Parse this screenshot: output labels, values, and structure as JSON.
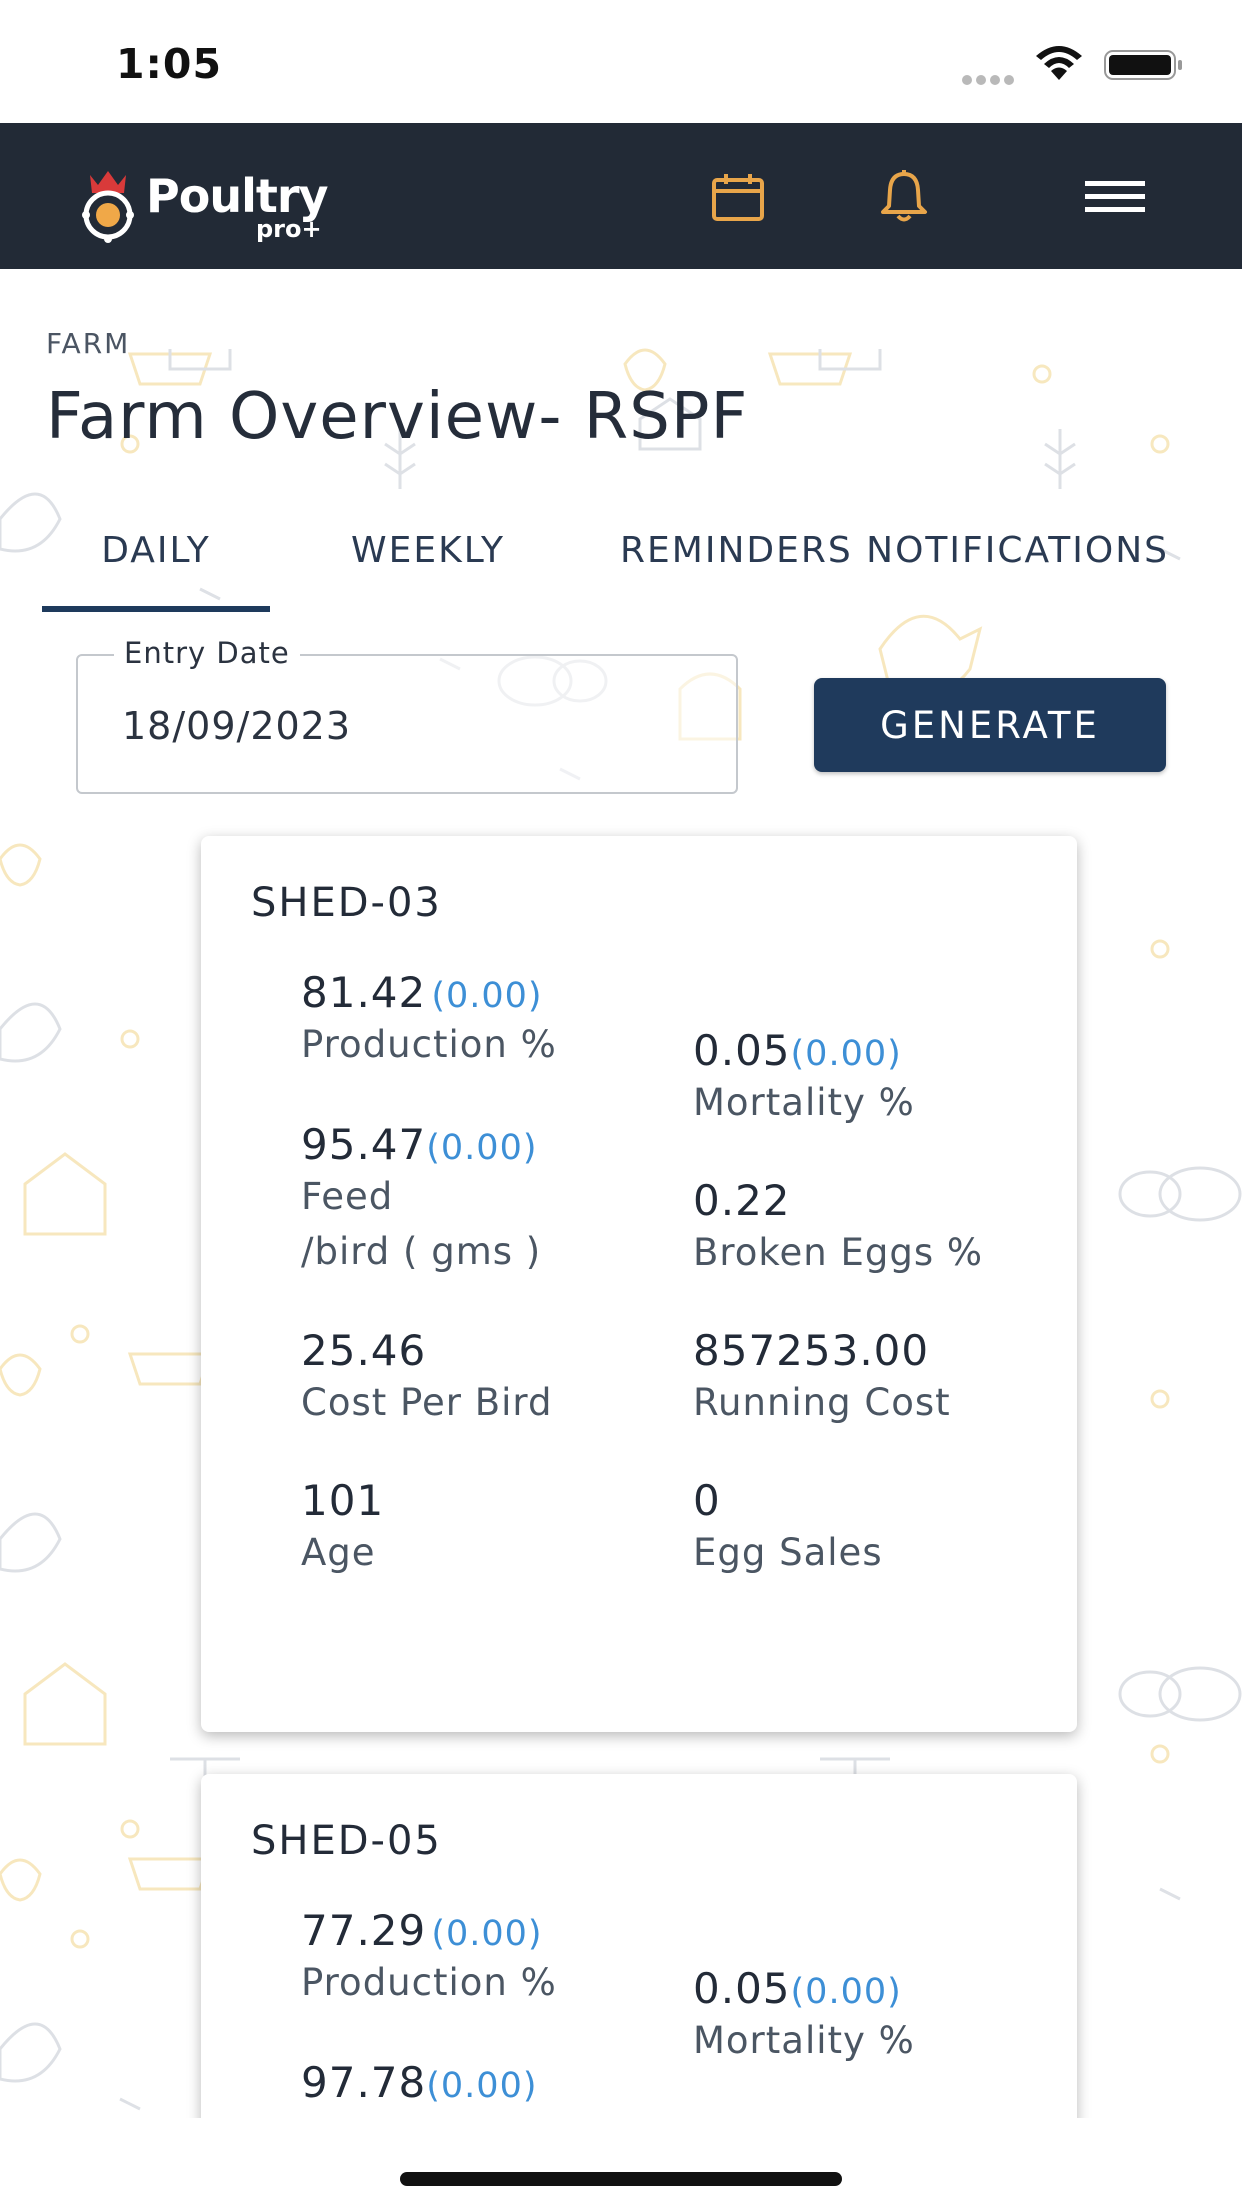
{
  "status_bar": {
    "time": "1:05"
  },
  "header": {
    "logo_text": "Poultry",
    "logo_sub": "pro+",
    "calendar_icon": "calendar-icon",
    "bell_icon": "bell-icon",
    "menu_icon": "menu-icon",
    "colors": {
      "bar": "#222a36",
      "icon_accent": "#e8a54a"
    }
  },
  "page": {
    "section_label": "FARM",
    "title": "Farm Overview- RSPF"
  },
  "tabs": [
    {
      "label": "DAILY",
      "active": true
    },
    {
      "label": "WEEKLY",
      "active": false
    },
    {
      "label": "REMINDERS NOTIFICATIONS",
      "active": false
    }
  ],
  "entry_date": {
    "label": "Entry Date",
    "value": "18/09/2023"
  },
  "generate_button": {
    "label": "GENERATE",
    "color": "#1f3a5c"
  },
  "sheds": [
    {
      "name": "SHED-03",
      "production": {
        "value": "81.42",
        "delta": "(0.00)",
        "label": "Production %"
      },
      "mortality": {
        "value": "0.05",
        "delta": "(0.00)",
        "label": "Mortality %"
      },
      "feed": {
        "value": "95.47",
        "delta": "(0.00)",
        "label": "Feed\n/bird ( gms )"
      },
      "broken_eggs": {
        "value": "0.22",
        "label": "Broken Eggs %"
      },
      "cost_per_bird": {
        "value": "25.46",
        "label": "Cost Per Bird"
      },
      "running_cost": {
        "value": "857253.00",
        "label": "Running Cost"
      },
      "age": {
        "value": "101",
        "label": "Age"
      },
      "egg_sales": {
        "value": "0",
        "label": "Egg Sales"
      }
    },
    {
      "name": "SHED-05",
      "production": {
        "value": "77.29",
        "delta": "(0.00)",
        "label": "Production %"
      },
      "mortality": {
        "value": "0.05",
        "delta": "(0.00)",
        "label": "Mortality %"
      },
      "feed": {
        "value": "97.78",
        "delta": "(0.00)"
      }
    }
  ]
}
